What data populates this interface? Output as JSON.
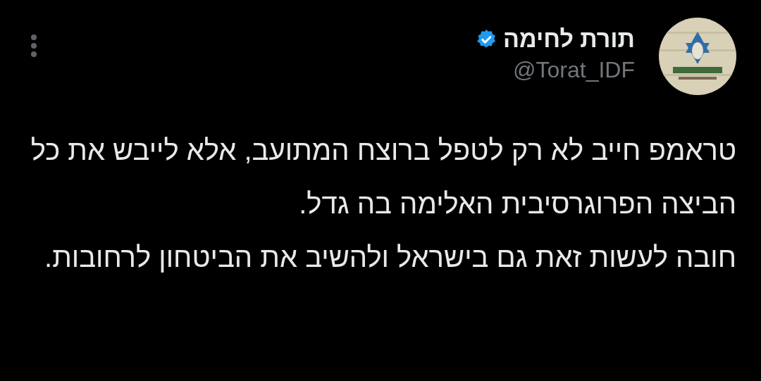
{
  "author": {
    "name": "תורת לחימה",
    "verified": true,
    "handle": "@Torat_IDF"
  },
  "tweet": {
    "paragraphs": [
      "טראמפ חייב לא רק לטפל ברוצח המתועב, אלא לייבש את כל הביצה הפרוגרסיבית האלימה בה גדל.",
      "חובה לעשות זאת גם בישראל ולהשיב את הביטחון לרחובות."
    ]
  }
}
